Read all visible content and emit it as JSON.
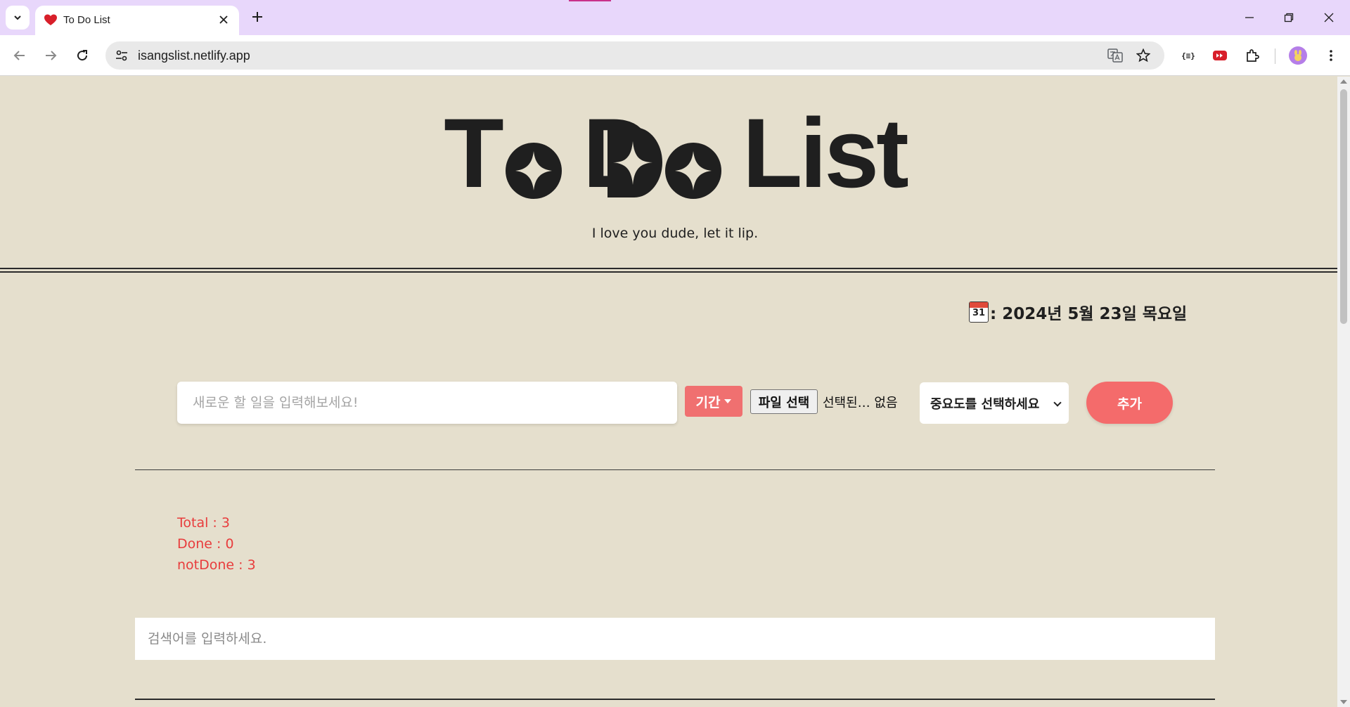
{
  "browser": {
    "tab_title": "To Do List",
    "url": "isangslist.netlify.app"
  },
  "header": {
    "title_word_1": "T",
    "title_word_2": "D",
    "title_word_3": "List",
    "subtitle": "I love you dude, let it lip."
  },
  "date": {
    "calendar_icon_number": "31",
    "text": ": 2024년 5월 23일 목요일"
  },
  "form": {
    "todo_placeholder": "새로운 할 일을 입력해보세요!",
    "period_label": "기간",
    "file_button_label": "파일 선택",
    "file_status": "선택된… 없음",
    "priority_selected": "중요도를 선택하세요",
    "add_label": "추가"
  },
  "stats": {
    "total": "Total : 3",
    "done": "Done : 0",
    "not_done": "notDone : 3"
  },
  "search": {
    "placeholder": "검색어를 입력하세요."
  },
  "colors": {
    "page_bg": "#e5dfcd",
    "accent": "#f46b6b",
    "stats_text": "#e83c3c",
    "tabstrip": "#e8d7fb"
  }
}
